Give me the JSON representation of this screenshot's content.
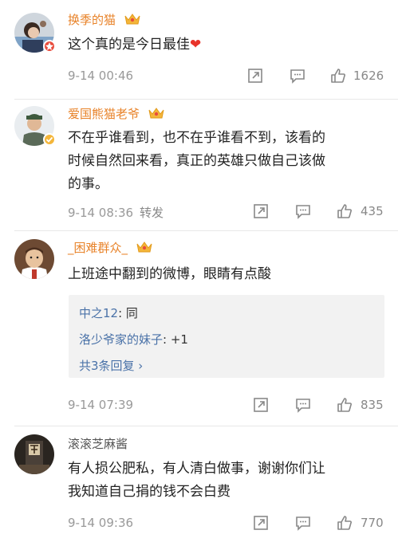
{
  "comments": [
    {
      "name": "换季的猫",
      "text": "这个真的是今日最佳",
      "heart": "❤",
      "time": "9-14 00:46",
      "forward_label": "",
      "likes": "1626"
    },
    {
      "name": "爱国熊猫老爷",
      "text_lines": [
        "不在乎谁看到，也不在乎谁看不到，该看的",
        "时候自然回来看，真正的英雄只做自己该做",
        "的事。"
      ],
      "time": "9-14 08:36",
      "forward_label": "转发",
      "likes": "435"
    },
    {
      "name": "_困难群众_",
      "text": "上班途中翻到的微博，眼睛有点酸",
      "replies": [
        {
          "name": "中之12",
          "text": ": 同"
        },
        {
          "name": "洛少爷家的妹子",
          "text": ": +1"
        }
      ],
      "more": "共3条回复 ›",
      "time": "9-14 07:39",
      "likes": "835"
    },
    {
      "name": "滚滚芝麻酱",
      "text_lines": [
        "有人损公肥私，有人清白做事，谢谢你们让",
        "我知道自己捐的钱不会白费"
      ],
      "time": "9-14 09:36",
      "likes": "770"
    }
  ],
  "icons": {
    "forward": "forward-icon",
    "comment": "comment-icon",
    "like": "thumbs-up-icon",
    "crown": "crown-icon"
  },
  "colors": {
    "name_orange": "#e8832a",
    "link_blue": "#4a72a8",
    "meta_gray": "#999999"
  }
}
